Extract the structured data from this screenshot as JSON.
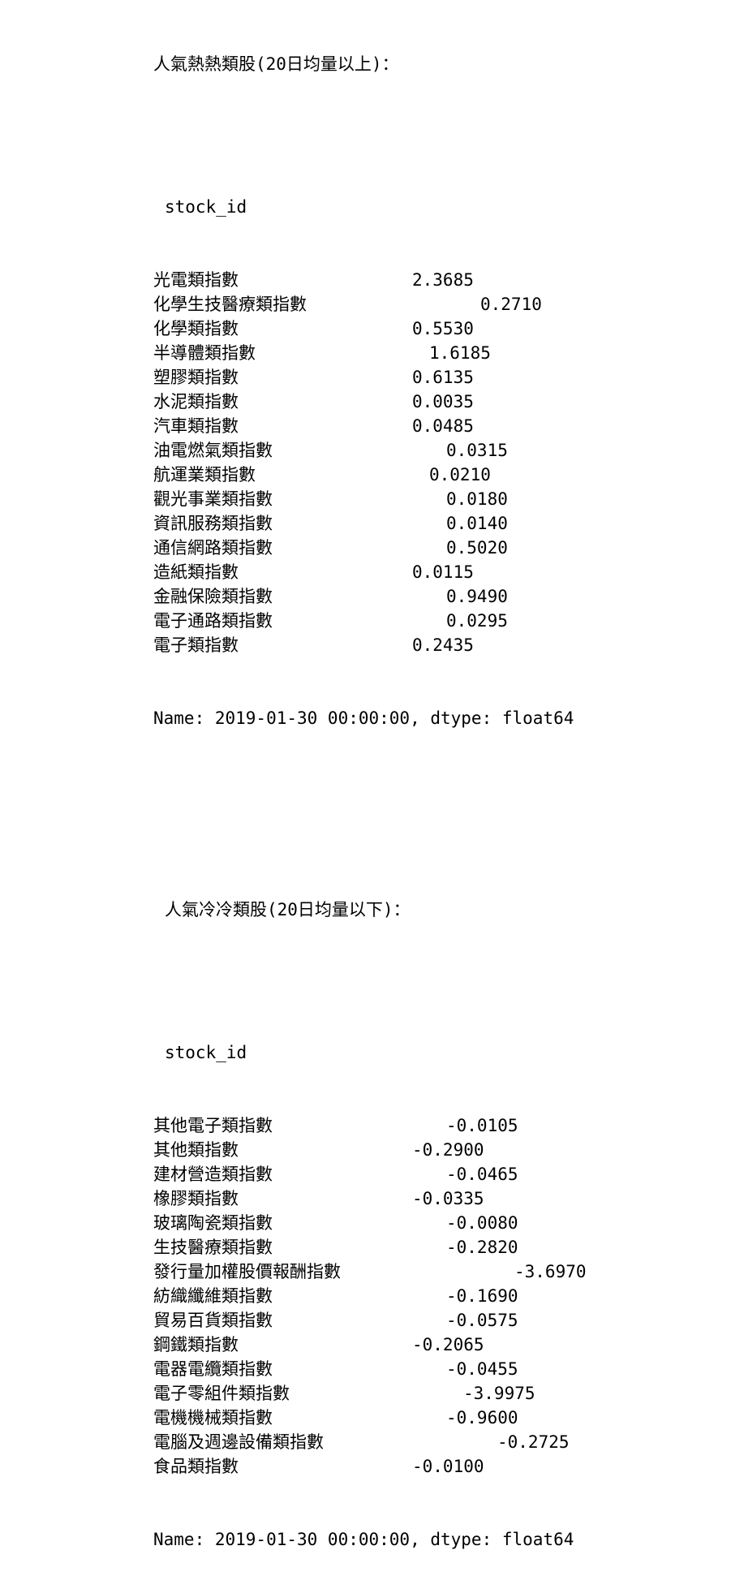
{
  "hot": {
    "title": "人氣熱熱類股(20日均量以上)：",
    "index_name": "stock_id",
    "rows": [
      {
        "label": "光電類指數",
        "value": "2.3685"
      },
      {
        "label": "化學生技醫療類指數",
        "value": "0.2710"
      },
      {
        "label": "化學類指數",
        "value": "0.5530"
      },
      {
        "label": "半導體類指數",
        "value": "1.6185"
      },
      {
        "label": "塑膠類指數",
        "value": "0.6135"
      },
      {
        "label": "水泥類指數",
        "value": "0.0035"
      },
      {
        "label": "汽車類指數",
        "value": "0.0485"
      },
      {
        "label": "油電燃氣類指數",
        "value": "0.0315"
      },
      {
        "label": "航運業類指數",
        "value": "0.0210"
      },
      {
        "label": "觀光事業類指數",
        "value": "0.0180"
      },
      {
        "label": "資訊服務類指數",
        "value": "0.0140"
      },
      {
        "label": "通信網路類指數",
        "value": "0.5020"
      },
      {
        "label": "造紙類指數",
        "value": "0.0115"
      },
      {
        "label": "金融保險類指數",
        "value": "0.9490"
      },
      {
        "label": "電子通路類指數",
        "value": "0.0295"
      },
      {
        "label": "電子類指數",
        "value": "0.2435"
      }
    ],
    "footer": "Name: 2019-01-30 00:00:00, dtype: float64"
  },
  "cold": {
    "title": "人氣冷冷類股(20日均量以下)：",
    "index_name": "stock_id",
    "rows": [
      {
        "label": "其他電子類指數",
        "value": "-0.0105"
      },
      {
        "label": "其他類指數",
        "value": "-0.2900"
      },
      {
        "label": "建材營造類指數",
        "value": "-0.0465"
      },
      {
        "label": "橡膠類指數",
        "value": "-0.0335"
      },
      {
        "label": "玻璃陶瓷類指數",
        "value": "-0.0080"
      },
      {
        "label": "生技醫療類指數",
        "value": "-0.2820"
      },
      {
        "label": "發行量加權股價報酬指數",
        "value": "-3.6970"
      },
      {
        "label": "紡織纖維類指數",
        "value": "-0.1690"
      },
      {
        "label": "貿易百貨類指數",
        "value": "-0.0575"
      },
      {
        "label": "鋼鐵類指數",
        "value": "-0.2065"
      },
      {
        "label": "電器電纜類指數",
        "value": "-0.0455"
      },
      {
        "label": "電子零組件類指數",
        "value": "-3.9975"
      },
      {
        "label": "電機機械類指數",
        "value": "-0.9600"
      },
      {
        "label": "電腦及週邊設備類指數",
        "value": "-0.2725"
      },
      {
        "label": "食品類指數",
        "value": "-0.0100"
      }
    ],
    "footer": "Name: 2019-01-30 00:00:00, dtype: float64"
  }
}
